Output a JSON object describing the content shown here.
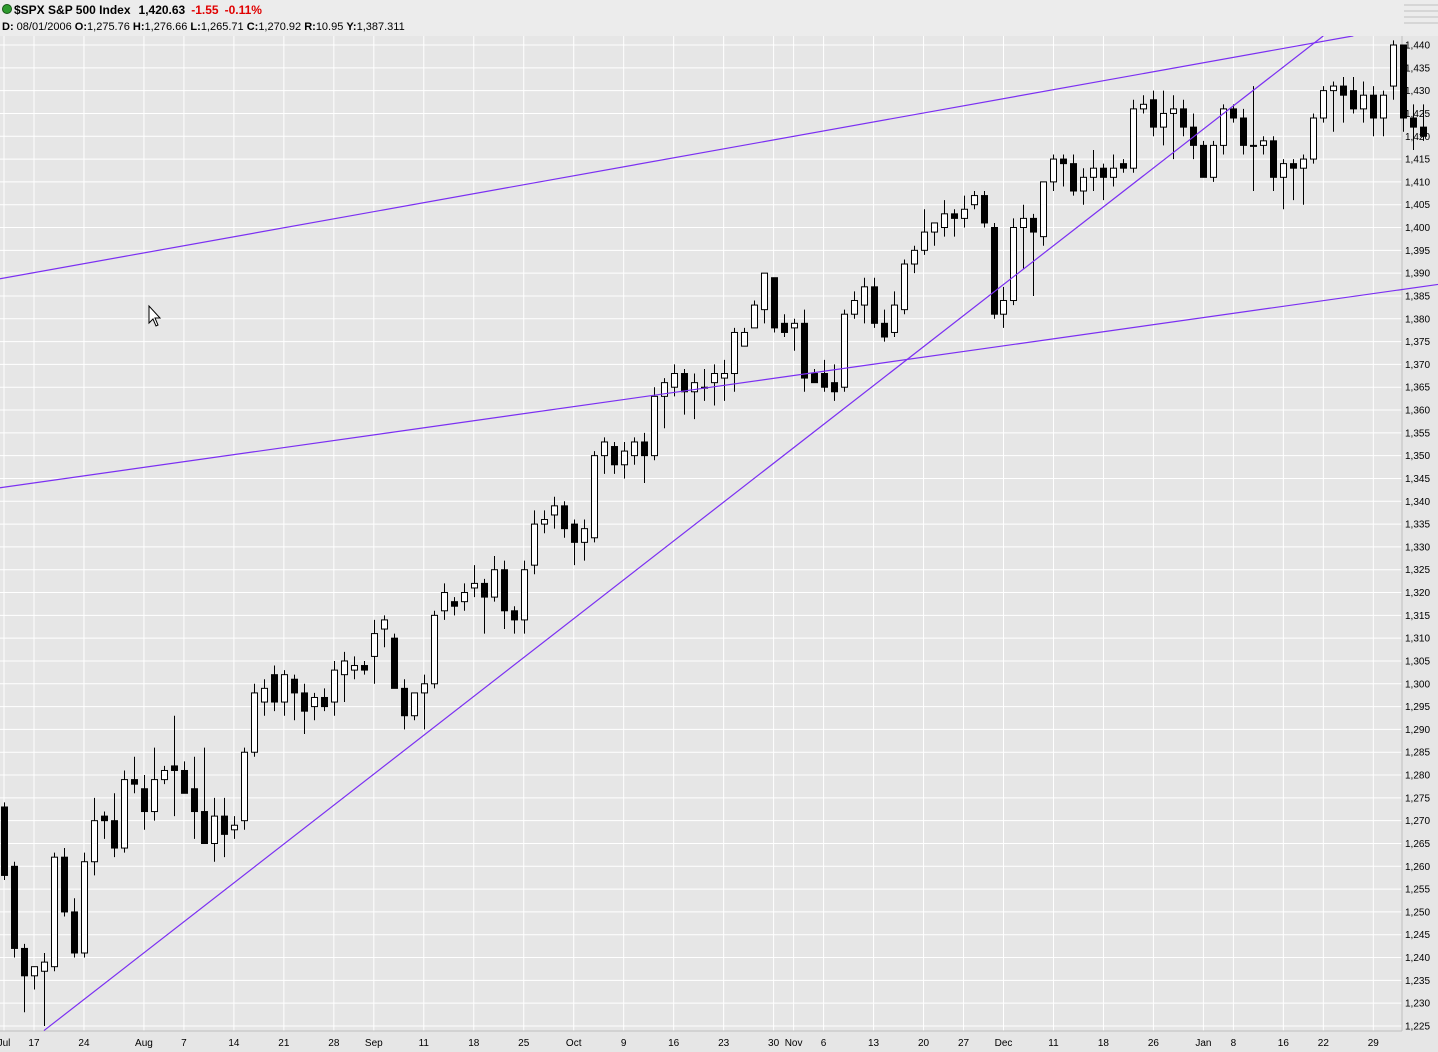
{
  "header": {
    "symbol": "$SPX S&P 500 Index",
    "last": "1,420.63",
    "change": "-1.55",
    "change_pct": "-0.11%",
    "ohlc": {
      "date_label": "D:",
      "date": "08/01/2006",
      "open_label": "O:",
      "open": "1,275.76",
      "high_label": "H:",
      "high": "1,276.66",
      "low_label": "L:",
      "low": "1,265.71",
      "close_label": "C:",
      "close": "1,270.92",
      "range_label": "R:",
      "range": "10.95",
      "y_label": "Y:",
      "y": "1,387.311"
    }
  },
  "colors": {
    "trendline": "#7b2ff2",
    "up_fill": "#ffffff",
    "down_fill": "#000000",
    "grid": "#ffffff",
    "background": "#e6e6e6"
  },
  "chart_data": {
    "type": "candlestick",
    "x_axis_labels": [
      {
        "text": "Jul",
        "day": 0
      },
      {
        "text": "17",
        "day": 3
      },
      {
        "text": "24",
        "day": 8
      },
      {
        "text": "Aug",
        "day": 14
      },
      {
        "text": "7",
        "day": 18
      },
      {
        "text": "14",
        "day": 23
      },
      {
        "text": "21",
        "day": 28
      },
      {
        "text": "28",
        "day": 33
      },
      {
        "text": "Sep",
        "day": 37
      },
      {
        "text": "11",
        "day": 42
      },
      {
        "text": "18",
        "day": 47
      },
      {
        "text": "25",
        "day": 52
      },
      {
        "text": "Oct",
        "day": 57
      },
      {
        "text": "9",
        "day": 62
      },
      {
        "text": "16",
        "day": 67
      },
      {
        "text": "23",
        "day": 72
      },
      {
        "text": "30",
        "day": 77
      },
      {
        "text": "Nov",
        "day": 79
      },
      {
        "text": "6",
        "day": 82
      },
      {
        "text": "13",
        "day": 87
      },
      {
        "text": "20",
        "day": 92
      },
      {
        "text": "27",
        "day": 96
      },
      {
        "text": "Dec",
        "day": 100
      },
      {
        "text": "11",
        "day": 105
      },
      {
        "text": "18",
        "day": 110
      },
      {
        "text": "26",
        "day": 115
      },
      {
        "text": "Jan",
        "day": 120
      },
      {
        "text": "8",
        "day": 123
      },
      {
        "text": "16",
        "day": 128
      },
      {
        "text": "22",
        "day": 132
      },
      {
        "text": "29",
        "day": 137
      }
    ],
    "y_axis": {
      "min": 1224,
      "max": 1441,
      "step": 5
    },
    "candles": [
      [
        1273,
        1274,
        1257,
        1258
      ],
      [
        1260,
        1261,
        1240,
        1242
      ],
      [
        1242,
        1243,
        1228,
        1236
      ],
      [
        1236,
        1238,
        1233,
        1238
      ],
      [
        1237,
        1241,
        1225,
        1239
      ],
      [
        1238,
        1263,
        1237,
        1262
      ],
      [
        1262,
        1264,
        1249,
        1250
      ],
      [
        1250,
        1253,
        1240,
        1241
      ],
      [
        1241,
        1263,
        1240,
        1261
      ],
      [
        1261,
        1275,
        1258,
        1270
      ],
      [
        1271,
        1272,
        1266,
        1270
      ],
      [
        1270,
        1276,
        1262,
        1264
      ],
      [
        1264,
        1281,
        1263,
        1279
      ],
      [
        1279,
        1284,
        1276,
        1278
      ],
      [
        1277,
        1280,
        1268,
        1272
      ],
      [
        1272,
        1286,
        1270,
        1279
      ],
      [
        1279,
        1282,
        1278,
        1281
      ],
      [
        1282,
        1293,
        1271,
        1281
      ],
      [
        1281,
        1283,
        1276,
        1276
      ],
      [
        1277,
        1284,
        1266,
        1272
      ],
      [
        1272,
        1286,
        1267,
        1265
      ],
      [
        1265,
        1275,
        1261,
        1271
      ],
      [
        1271,
        1275,
        1262,
        1267
      ],
      [
        1268,
        1271,
        1266,
        1269
      ],
      [
        1270,
        1286,
        1268,
        1285
      ],
      [
        1285,
        1300,
        1284,
        1298
      ],
      [
        1296,
        1301,
        1293,
        1299
      ],
      [
        1302,
        1304,
        1294,
        1296
      ],
      [
        1296,
        1303,
        1293,
        1302
      ],
      [
        1301,
        1302,
        1292,
        1298
      ],
      [
        1298,
        1300,
        1289,
        1294
      ],
      [
        1295,
        1298,
        1292,
        1297
      ],
      [
        1297,
        1299,
        1294,
        1295
      ],
      [
        1296,
        1305,
        1293,
        1303
      ],
      [
        1302,
        1307,
        1296,
        1305
      ],
      [
        1303,
        1306,
        1301,
        1304
      ],
      [
        1304,
        1305,
        1302,
        1303
      ],
      [
        1306,
        1314,
        1300,
        1311
      ],
      [
        1312,
        1315,
        1308,
        1314
      ],
      [
        1310,
        1311,
        1299,
        1299
      ],
      [
        1299,
        1301,
        1290,
        1293
      ],
      [
        1293,
        1297,
        1292,
        1298
      ],
      [
        1298,
        1302,
        1290,
        1300
      ],
      [
        1300,
        1316,
        1299,
        1315
      ],
      [
        1316,
        1322,
        1314,
        1320
      ],
      [
        1318,
        1319,
        1315,
        1317
      ],
      [
        1318,
        1322,
        1316,
        1320
      ],
      [
        1321,
        1326,
        1319,
        1322
      ],
      [
        1322,
        1323,
        1311,
        1319
      ],
      [
        1319,
        1328,
        1318,
        1325
      ],
      [
        1325,
        1327,
        1312,
        1316
      ],
      [
        1316,
        1317,
        1311,
        1314
      ],
      [
        1314,
        1327,
        1311,
        1325
      ],
      [
        1326,
        1338,
        1324,
        1335
      ],
      [
        1335,
        1338,
        1333,
        1336
      ],
      [
        1337,
        1341,
        1334,
        1339
      ],
      [
        1339,
        1340,
        1332,
        1334
      ],
      [
        1335,
        1336,
        1326,
        1331
      ],
      [
        1331,
        1336,
        1327,
        1334
      ],
      [
        1332,
        1351,
        1331,
        1350
      ],
      [
        1350,
        1354,
        1346,
        1353
      ],
      [
        1352,
        1353,
        1346,
        1348
      ],
      [
        1348,
        1353,
        1345,
        1351
      ],
      [
        1350,
        1354,
        1348,
        1353
      ],
      [
        1353,
        1355,
        1344,
        1350
      ],
      [
        1350,
        1365,
        1349,
        1363
      ],
      [
        1363,
        1367,
        1356,
        1366
      ],
      [
        1365,
        1370,
        1363,
        1368
      ],
      [
        1368,
        1369,
        1359,
        1364
      ],
      [
        1364,
        1368,
        1358,
        1366
      ],
      [
        1365,
        1369,
        1362,
        1365
      ],
      [
        1366,
        1370,
        1361,
        1368
      ],
      [
        1367,
        1371,
        1362,
        1368
      ],
      [
        1368,
        1378,
        1364,
        1377
      ],
      [
        1374,
        1378,
        1374,
        1377
      ],
      [
        1378,
        1384,
        1378,
        1383
      ],
      [
        1382,
        1389,
        1379,
        1390
      ],
      [
        1389,
        1389,
        1377,
        1378
      ],
      [
        1379,
        1381,
        1376,
        1377
      ],
      [
        1378,
        1380,
        1373,
        1379
      ],
      [
        1379,
        1382,
        1364,
        1367
      ],
      [
        1368,
        1369,
        1366,
        1366
      ],
      [
        1368,
        1371,
        1364,
        1365
      ],
      [
        1366,
        1370,
        1362,
        1364
      ],
      [
        1365,
        1382,
        1364,
        1381
      ],
      [
        1381,
        1386,
        1380,
        1384
      ],
      [
        1383,
        1389,
        1379,
        1387
      ],
      [
        1387,
        1389,
        1378,
        1379
      ],
      [
        1379,
        1382,
        1375,
        1376
      ],
      [
        1377,
        1386,
        1376,
        1383
      ],
      [
        1382,
        1393,
        1381,
        1392
      ],
      [
        1392,
        1396,
        1390,
        1395
      ],
      [
        1395,
        1404,
        1394,
        1399
      ],
      [
        1399,
        1401,
        1396,
        1401
      ],
      [
        1400,
        1406,
        1398,
        1403
      ],
      [
        1403,
        1404,
        1398,
        1402
      ],
      [
        1402,
        1407,
        1400,
        1404
      ],
      [
        1405,
        1408,
        1404,
        1407
      ],
      [
        1407,
        1408,
        1400,
        1401
      ],
      [
        1400,
        1401,
        1380,
        1381
      ],
      [
        1381,
        1387,
        1378,
        1384
      ],
      [
        1384,
        1402,
        1383,
        1400
      ],
      [
        1400,
        1405,
        1391,
        1402
      ],
      [
        1402,
        1403,
        1385,
        1399
      ],
      [
        1398,
        1401,
        1396,
        1410
      ],
      [
        1410,
        1416,
        1408,
        1415
      ],
      [
        1415,
        1416,
        1409,
        1414
      ],
      [
        1414,
        1416,
        1407,
        1408
      ],
      [
        1408,
        1413,
        1405,
        1411
      ],
      [
        1411,
        1417,
        1408,
        1413
      ],
      [
        1413,
        1414,
        1406,
        1411
      ],
      [
        1411,
        1416,
        1409,
        1413
      ],
      [
        1414,
        1415,
        1412,
        1413
      ],
      [
        1413,
        1428,
        1412,
        1426
      ],
      [
        1426,
        1429,
        1425,
        1427
      ],
      [
        1428,
        1430,
        1420,
        1422
      ],
      [
        1422,
        1430,
        1418,
        1425
      ],
      [
        1425,
        1429,
        1415,
        1426
      ],
      [
        1426,
        1428,
        1420,
        1422
      ],
      [
        1422,
        1425,
        1415,
        1418
      ],
      [
        1418,
        1419,
        1411,
        1411
      ],
      [
        1411,
        1419,
        1410,
        1418
      ],
      [
        1418,
        1427,
        1416,
        1426
      ],
      [
        1426,
        1427,
        1423,
        1424
      ],
      [
        1424,
        1426,
        1416,
        1418
      ],
      [
        1418,
        1431,
        1408,
        1418
      ],
      [
        1418,
        1420,
        1416,
        1419
      ],
      [
        1419,
        1420,
        1408,
        1411
      ],
      [
        1411,
        1415,
        1404,
        1414
      ],
      [
        1414,
        1415,
        1406,
        1413
      ],
      [
        1413,
        1416,
        1405,
        1415
      ],
      [
        1415,
        1425,
        1414,
        1424
      ],
      [
        1424,
        1431,
        1423,
        1430
      ],
      [
        1430,
        1432,
        1421,
        1431
      ],
      [
        1431,
        1433,
        1423,
        1429
      ],
      [
        1430,
        1433,
        1425,
        1426
      ],
      [
        1426,
        1432,
        1423,
        1429
      ],
      [
        1429,
        1431,
        1420,
        1424
      ],
      [
        1424,
        1430,
        1420,
        1429
      ],
      [
        1431,
        1441,
        1428,
        1440
      ],
      [
        1440,
        1440,
        1421,
        1424
      ],
      [
        1424,
        1427,
        1417,
        1422
      ],
      [
        1422,
        1427,
        1419,
        1420
      ]
    ],
    "trendlines": [
      {
        "name": "upper-channel-line",
        "p1": {
          "day": -10,
          "price": 1385
        },
        "p2": {
          "day": 135,
          "price": 1442
        }
      },
      {
        "name": "lower-channel-line",
        "p1": {
          "day": -10,
          "price": 1340
        },
        "p2": {
          "day": 145,
          "price": 1388
        }
      },
      {
        "name": "rising-support-line",
        "p1": {
          "day": 4,
          "price": 1224
        },
        "p2": {
          "day": 132,
          "price": 1442
        }
      }
    ]
  }
}
